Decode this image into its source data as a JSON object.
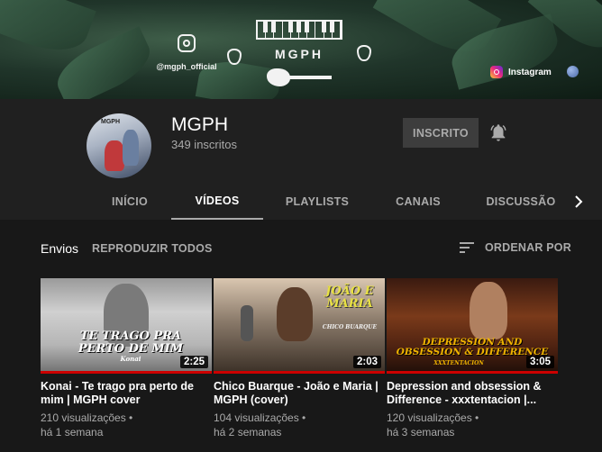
{
  "banner": {
    "instagram_handle": "@mgph_official",
    "brand": "MGPH",
    "link_label": "Instagram"
  },
  "channel": {
    "avatar_label": "MGPH",
    "name": "MGPH",
    "subscribers": "349 inscritos",
    "subscribe_label": "INSCRITO"
  },
  "tabs": [
    {
      "label": "INÍCIO",
      "active": false
    },
    {
      "label": "VÍDEOS",
      "active": true
    },
    {
      "label": "PLAYLISTS",
      "active": false
    },
    {
      "label": "CANAIS",
      "active": false
    },
    {
      "label": "DISCUSSÃO",
      "active": false
    }
  ],
  "section": {
    "title": "Envios",
    "play_all": "REPRODUZIR TODOS",
    "sort_label": "ORDENAR POR"
  },
  "videos": [
    {
      "thumb_text": "TE TRAGO PRA PERTO DE MIM",
      "thumb_sub": "Konai",
      "duration": "2:25",
      "title": "Konai - Te trago pra perto de mim | MGPH cover",
      "views": "210 visualizações •",
      "age": "há 1 semana"
    },
    {
      "thumb_text": "JOÃO E MARIA",
      "thumb_sub": "CHICO BUARQUE",
      "duration": "2:03",
      "title": "Chico Buarque - João e Maria | MGPH (cover)",
      "views": "104 visualizações •",
      "age": "há 2 semanas"
    },
    {
      "thumb_text": "DEPRESSION AND OBSESSION & DIFFERENCE",
      "thumb_sub": "XXXTENTACION",
      "duration": "3:05",
      "title": "Depression and obsession & Difference - xxxtentacion |...",
      "views": "120 visualizações •",
      "age": "há 3 semanas"
    }
  ],
  "colors": {
    "accent_red": "#cc0000",
    "thumb2_text": "#e8e044",
    "thumb3_text": "#f0b400"
  }
}
